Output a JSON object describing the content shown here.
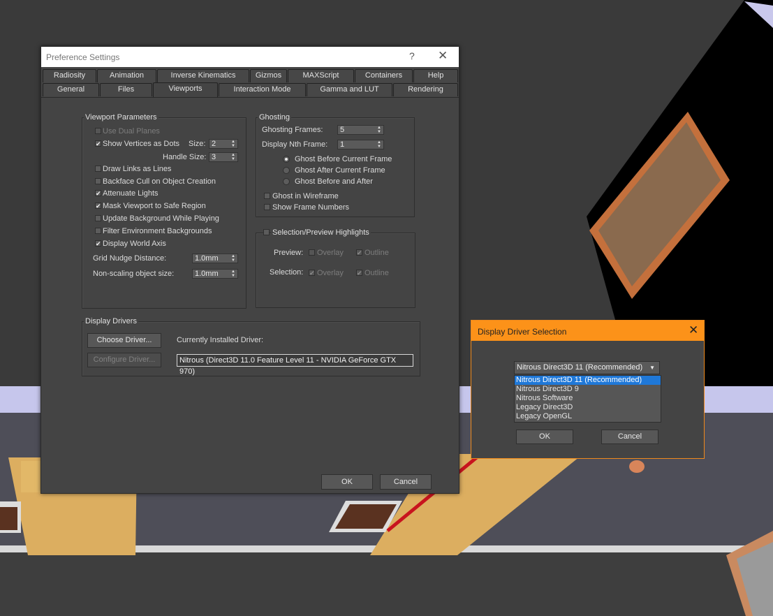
{
  "preferences": {
    "title": "Preference Settings",
    "help_glyph": "?",
    "close_glyph": "✕",
    "tabs_row1": [
      "Radiosity",
      "Animation",
      "Inverse Kinematics",
      "Gizmos",
      "MAXScript",
      "Containers",
      "Help"
    ],
    "tabs_row2": [
      "General",
      "Files",
      "Viewports",
      "Interaction Mode",
      "Gamma and LUT",
      "Rendering"
    ],
    "active_tab": "Viewports",
    "viewport_parameters": {
      "title": "Viewport Parameters",
      "use_dual_planes": "Use Dual Planes",
      "show_vertices": "Show Vertices as Dots",
      "size_label": "Size:",
      "size_value": "2",
      "handle_size_label": "Handle Size:",
      "handle_size_value": "3",
      "draw_links": "Draw Links as Lines",
      "backface_cull": "Backface Cull on Object Creation",
      "attenuate_lights": "Attenuate Lights",
      "mask_viewport": "Mask Viewport to Safe Region",
      "update_background": "Update Background While Playing",
      "filter_env": "Filter Environment Backgrounds",
      "display_world_axis": "Display World Axis",
      "grid_nudge_label": "Grid Nudge Distance:",
      "grid_nudge_value": "1.0mm",
      "non_scaling_label": "Non-scaling object size:",
      "non_scaling_value": "1.0mm"
    },
    "ghosting": {
      "title": "Ghosting",
      "frames_label": "Ghosting Frames:",
      "frames_value": "5",
      "nth_label": "Display Nth Frame:",
      "nth_value": "1",
      "before": "Ghost Before Current Frame",
      "after": "Ghost After Current Frame",
      "before_after": "Ghost Before and After",
      "wireframe": "Ghost in Wireframe",
      "frame_numbers": "Show Frame Numbers"
    },
    "highlights": {
      "title": "Selection/Preview Highlights",
      "preview_label": "Preview:",
      "selection_label": "Selection:",
      "overlay": "Overlay",
      "outline": "Outline"
    },
    "display_drivers": {
      "title": "Display Drivers",
      "choose_button": "Choose Driver...",
      "configure_button": "Configure Driver...",
      "installed_label": "Currently Installed Driver:",
      "installed_value": "Nitrous (Direct3D 11.0 Feature Level 11 - NVIDIA GeForce GTX 970)"
    },
    "ok_button": "OK",
    "cancel_button": "Cancel"
  },
  "driver_dialog": {
    "title": "Display Driver Selection",
    "close_glyph": "✕",
    "selected": "Nitrous Direct3D 11 (Recommended)",
    "options": [
      "Nitrous Direct3D 11 (Recommended)",
      "Nitrous Direct3D 9",
      "Nitrous Software",
      "Legacy Direct3D",
      "Legacy OpenGL"
    ],
    "ok_button": "OK",
    "cancel_button": "Cancel"
  },
  "colors": {
    "dialog_bg": "#444444",
    "driver_title_bg": "#fc9219",
    "list_highlight": "#1f78d8",
    "arrow": "#c8141e"
  }
}
